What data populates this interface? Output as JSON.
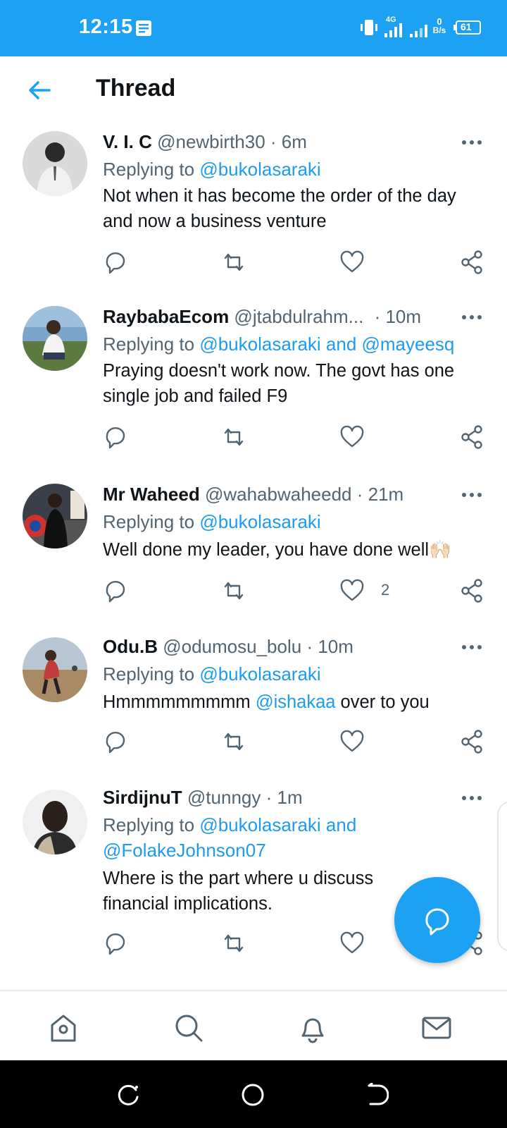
{
  "status_bar": {
    "time": "12:15",
    "network": "4G",
    "net_speed_value": "0",
    "net_speed_unit": "B/s",
    "battery": "61"
  },
  "header": {
    "title": "Thread"
  },
  "colors": {
    "accent": "#1da1f2",
    "link": "#1d9bf0"
  },
  "tweets": [
    {
      "name": "V. I. C",
      "handle": "@newbirth30",
      "time": "· 6m",
      "replying_prefix": "Replying to ",
      "replying_to": "@bukolasaraki",
      "text": "Not when it has become the order of the day and now a business venture"
    },
    {
      "name": "RaybabaEcom",
      "handle": "@jtabdulrahm...",
      "time": "· 10m",
      "replying_prefix": "Replying to ",
      "replying_to": "@bukolasaraki and @mayeesq",
      "text": "Praying doesn't work now. The govt has one single job and failed F9"
    },
    {
      "name": "Mr Waheed",
      "handle": "@wahabwaheedd",
      "time": "· 21m",
      "replying_prefix": "Replying to ",
      "replying_to": "@bukolasaraki",
      "text": "Well done my leader, you have done well",
      "emoji": "🙌🏻",
      "like_count": "2"
    },
    {
      "name": "Odu.B",
      "handle": "@odumosu_bolu",
      "time": "· 10m",
      "replying_prefix": "Replying to ",
      "replying_to": "@bukolasaraki",
      "text_before": "Hmmmmmmmmm ",
      "mention": "@ishakaa",
      "text_after": " over to you"
    },
    {
      "name": "SirdijnuT",
      "handle": "@tunngy",
      "time": "· 1m",
      "replying_prefix": "Replying to ",
      "replying_to_line1": "@bukolasaraki and",
      "replying_to_line2": "@FolakeJohnson07",
      "text": "Where is the part where u discuss financial implications."
    }
  ],
  "icons": {
    "back": "arrow-left-icon",
    "reply": "reply-icon",
    "retweet": "retweet-icon",
    "like": "heart-icon",
    "share": "share-icon",
    "more": "more-icon",
    "compose": "compose-reply-icon",
    "home": "home-icon",
    "search": "search-icon",
    "notifications": "bell-icon",
    "messages": "mail-icon"
  }
}
